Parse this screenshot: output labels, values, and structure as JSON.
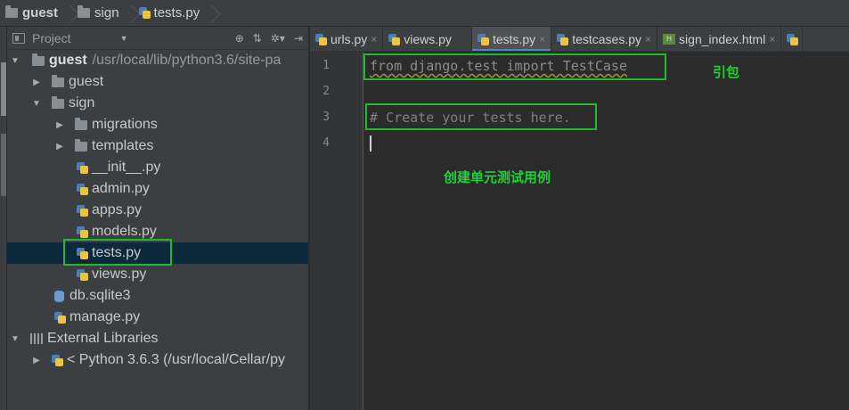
{
  "breadcrumb": {
    "root": "guest",
    "folder": "sign",
    "file": "tests.py"
  },
  "project_panel": {
    "title": "Project",
    "header_icons": [
      "target-icon",
      "collapse-icon",
      "gear-icon",
      "hide-icon"
    ]
  },
  "tree": {
    "root_name": "guest",
    "root_path": "/usr/local/lib/python3.6/site-pa",
    "guest_folder": "guest",
    "sign_folder": "sign",
    "migrations": "migrations",
    "templates": "templates",
    "init": "__init__.py",
    "admin": "admin.py",
    "apps": "apps.py",
    "models": "models.py",
    "tests": "tests.py",
    "views": "views.py",
    "db": "db.sqlite3",
    "manage": "manage.py",
    "ext_libs": "External Libraries",
    "python": "< Python 3.6.3 (/usr/local/Cellar/py"
  },
  "tabs": [
    {
      "label": "urls.py",
      "close": "×"
    },
    {
      "label": "views.py",
      "close": ""
    },
    {
      "label": "tests.py",
      "close": "×"
    },
    {
      "label": "testcases.py",
      "close": "×"
    },
    {
      "label": "sign_index.html",
      "close": "×"
    }
  ],
  "editor": {
    "line_numbers": [
      "1",
      "2",
      "3",
      "4"
    ],
    "line1": "from django.test import TestCase",
    "line3": "# Create your tests here."
  },
  "annotations": {
    "import_note": "引包",
    "test_note": "创建单元测试用例"
  },
  "colors": {
    "highlight_box": "#1ebc2b",
    "note_text": "#1ed236",
    "selection": "#0d293e",
    "tab_active_underline": "#4a88c7"
  }
}
